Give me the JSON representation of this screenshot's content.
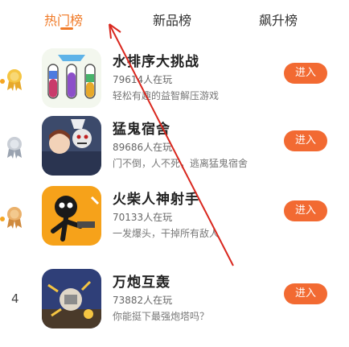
{
  "tabs": [
    {
      "label": "热门榜",
      "active": true
    },
    {
      "label": "新品榜",
      "active": false
    },
    {
      "label": "飙升榜",
      "active": false
    }
  ],
  "colors": {
    "accent": "#f07a27",
    "button": "#f26a32"
  },
  "games": [
    {
      "rank": "1",
      "rank_badge": "gold-medal-icon",
      "title": "水排序大挑战",
      "players": "79614人在玩",
      "desc": "轻松有趣的益智解压游戏",
      "button": "进入"
    },
    {
      "rank": "2",
      "rank_badge": "silver-medal-icon",
      "title": "猛鬼宿舍",
      "players": "89686人在玩",
      "desc": "门不倒，人不死，逃离猛鬼宿舍",
      "button": "进入"
    },
    {
      "rank": "3",
      "rank_badge": "bronze-medal-icon",
      "title": "火柴人神射手",
      "players": "70133人在玩",
      "desc": "一发爆头，干掉所有敌人",
      "button": "进入"
    },
    {
      "rank": "4",
      "rank_badge": "",
      "title": "万炮互轰",
      "players": "73882人在玩",
      "desc": "你能挺下最强炮塔吗？",
      "button": "进入"
    }
  ]
}
